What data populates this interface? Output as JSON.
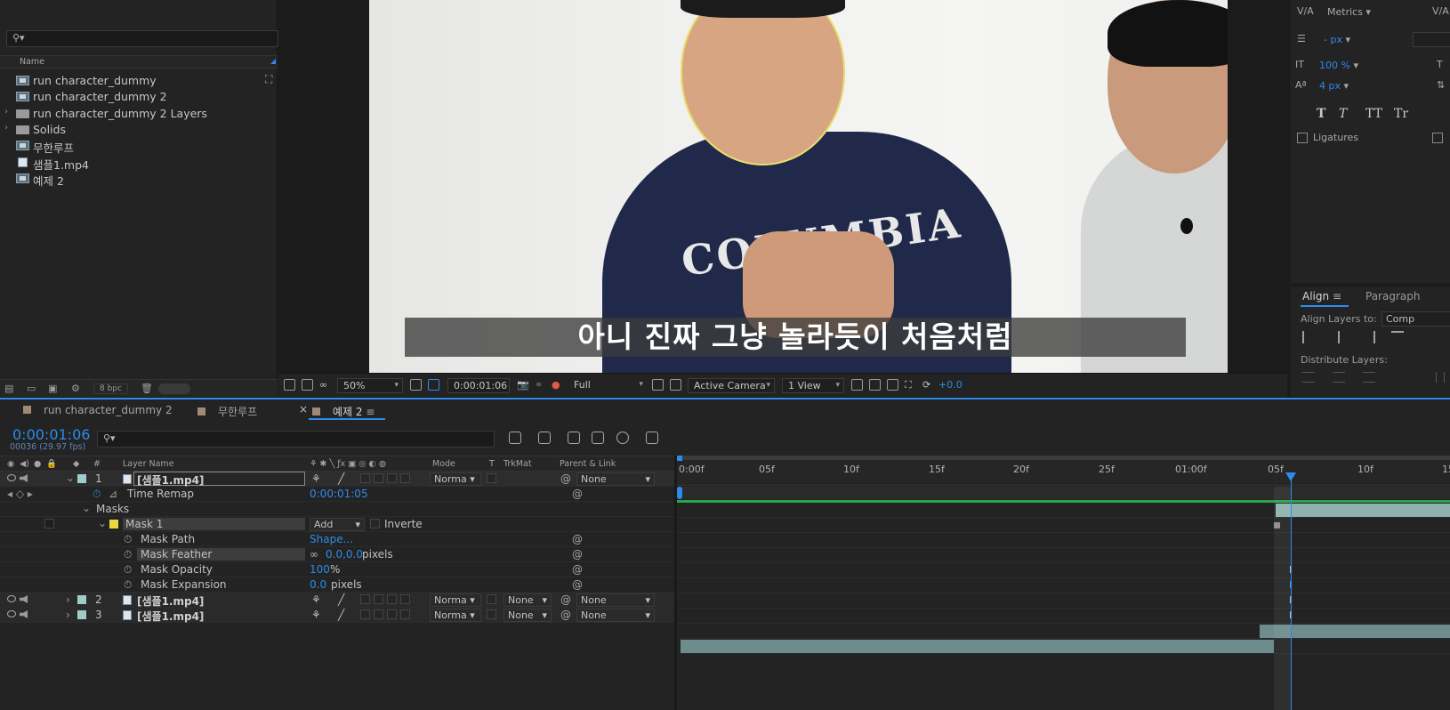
{
  "project": {
    "column_name": "Name",
    "items": [
      {
        "name": "run character_dummy",
        "type": "comp"
      },
      {
        "name": "run character_dummy 2",
        "type": "comp"
      },
      {
        "name": "run character_dummy 2 Layers",
        "type": "folder"
      },
      {
        "name": "Solids",
        "type": "folder"
      },
      {
        "name": "무한루프",
        "type": "comp"
      },
      {
        "name": "샘플1.mp4",
        "type": "video"
      },
      {
        "name": "예제 2",
        "type": "comp"
      }
    ],
    "bpc": "8 bpc"
  },
  "viewer": {
    "subtitle": "아니 진짜 그냥 놀라듯이 처음처럼",
    "shirt_text": "COLUMBIA",
    "zoom": "50%",
    "timecode": "0:00:01:06",
    "resolution": "Full",
    "camera": "Active Camera",
    "view": "1 View",
    "exposure": "+0.0"
  },
  "character": {
    "kerning_label": "Metrics",
    "leading": "- px",
    "vscale": "100 %",
    "baseline": "4 px",
    "tt_buttons": [
      "T",
      "T",
      "TT",
      "Tr"
    ],
    "ligatures": "Ligatures"
  },
  "align": {
    "tab": "Align",
    "tab2": "Paragraph",
    "align_to_label": "Align Layers to:",
    "align_to_value": "Comp",
    "distribute": "Distribute Layers:"
  },
  "timeline": {
    "tabs": [
      "run character_dummy 2",
      "무한루프",
      "예제 2"
    ],
    "current_time": "0:00:01:06",
    "frames": "00036 (29.97 fps)",
    "columns": {
      "hash": "#",
      "layer_name": "Layer Name",
      "mode": "Mode",
      "t": "T",
      "trkmat": "TrkMat",
      "parent": "Parent & Link"
    },
    "ruler_ticks": [
      "0:00f",
      "05f",
      "10f",
      "15f",
      "20f",
      "25f",
      "01:00f",
      "05f",
      "10f",
      "15"
    ],
    "layers": {
      "l1": {
        "num": "1",
        "name": "[샘플1.mp4]",
        "mode": "Norma",
        "parent": "None"
      },
      "time_remap": {
        "label": "Time Remap",
        "value": "0:00:01:05"
      },
      "masks": "Masks",
      "mask1": {
        "label": "Mask 1",
        "mode": "Add",
        "inverted": "Inverte"
      },
      "mask_path": {
        "label": "Mask Path",
        "value": "Shape..."
      },
      "mask_feather": {
        "label": "Mask Feather",
        "value": "0.0,0.0",
        "unit": "pixels"
      },
      "mask_opacity": {
        "label": "Mask Opacity",
        "value": "100",
        "unit": "%"
      },
      "mask_expansion": {
        "label": "Mask Expansion",
        "value": "0.0",
        "unit": "pixels"
      },
      "l2": {
        "num": "2",
        "name": "[샘플1.mp4]",
        "mode": "Norma",
        "trkmat": "None",
        "parent": "None"
      },
      "l3": {
        "num": "3",
        "name": "[샘플1.mp4]",
        "mode": "Norma",
        "trkmat": "None",
        "parent": "None"
      }
    }
  },
  "colors": {
    "accent": "#2d8ceb",
    "layer_label": "#9fcbc8",
    "mask_label": "#e8d840",
    "work_area": "#2aa64a"
  }
}
